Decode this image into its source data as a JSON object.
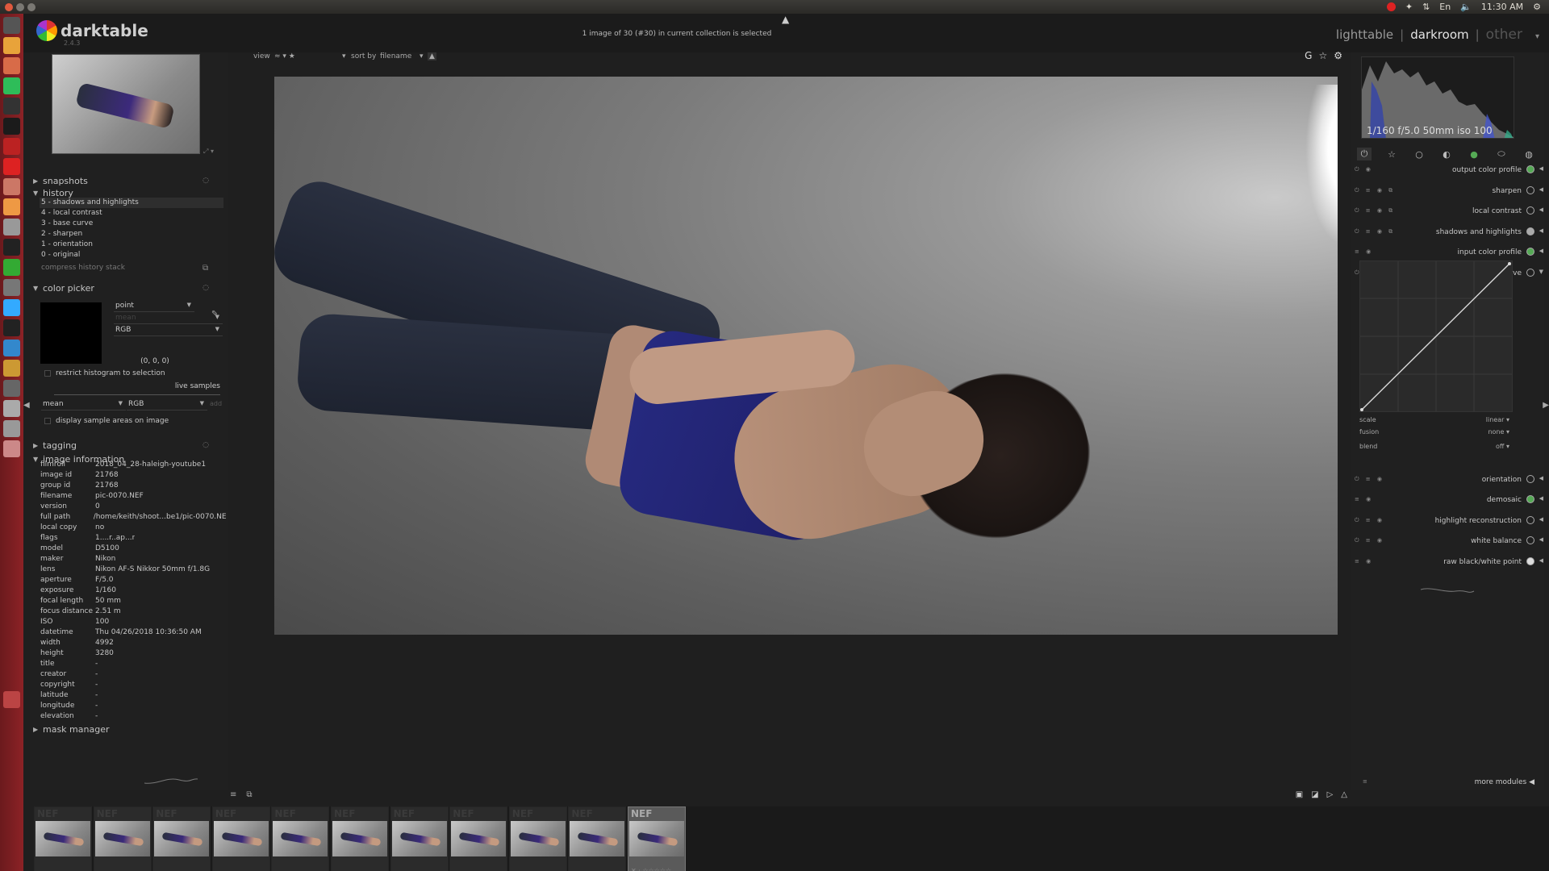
{
  "system_bar": {
    "time": "11:30 AM",
    "lang": "En"
  },
  "launcher": {
    "icons": [
      "dash-icon",
      "chrome-icon",
      "files-icon",
      "spotify-icon",
      "terminal-icon",
      "screen-icon",
      "darktable-icon",
      "opera-icon",
      "tools-icon",
      "amazon-icon",
      "disk-icon",
      "terminal2-icon",
      "spreadsheet-icon",
      "screenshot-icon",
      "twitter-icon",
      "text-editor-icon",
      "browser-icon",
      "paint-icon",
      "settings-icon",
      "drive-icon",
      "drive2-icon",
      "usb-icon",
      "trash-icon"
    ],
    "colors": [
      "#555",
      "#e8a33a",
      "#d86b48",
      "#2ebd59",
      "#333",
      "#1b1b1b",
      "#b22",
      "#d22",
      "#c76",
      "#e94",
      "#999",
      "#222",
      "#3a3",
      "#777",
      "#3af",
      "#222",
      "#38c",
      "#c93",
      "#666",
      "#aaa",
      "#999",
      "#c88",
      "#b44"
    ]
  },
  "header": {
    "app_name": "darktable",
    "version": "2.4.3",
    "status": "1 image of 30 (#30) in current collection is selected",
    "views": {
      "lighttable": "lighttable",
      "darkroom": "darkroom",
      "other": "other",
      "sep": "|"
    }
  },
  "left": {
    "snapshots": "snapshots",
    "history": {
      "title": "history",
      "items": [
        "5 - shadows and highlights",
        "4 - local contrast",
        "3 - base curve",
        "2 - sharpen",
        "1 - orientation",
        "0 - original"
      ],
      "compress": "compress history stack"
    },
    "color_picker": {
      "title": "color picker",
      "mode": "point",
      "stat": "mean",
      "model": "RGB",
      "value": "(0, 0, 0)",
      "restrict": "restrict histogram to selection",
      "live_samples": "live samples",
      "sample_stat": "mean",
      "sample_model": "RGB",
      "add": "add",
      "display_samples": "display sample areas on image"
    },
    "tagging": "tagging",
    "image_information": {
      "title": "image information",
      "rows": [
        {
          "k": "filmroll",
          "v": "2018_04_28-haleigh-youtube1"
        },
        {
          "k": "image id",
          "v": "21768"
        },
        {
          "k": "group id",
          "v": "21768"
        },
        {
          "k": "filename",
          "v": "pic-0070.NEF"
        },
        {
          "k": "version",
          "v": "0"
        },
        {
          "k": "full path",
          "v": "/home/keith/shoot...be1/pic-0070.NEF"
        },
        {
          "k": "local copy",
          "v": "no"
        },
        {
          "k": "flags",
          "v": "1....r..ap...r"
        },
        {
          "k": "model",
          "v": "D5100"
        },
        {
          "k": "maker",
          "v": "Nikon"
        },
        {
          "k": "lens",
          "v": "Nikon AF-S Nikkor 50mm f/1.8G"
        },
        {
          "k": "aperture",
          "v": "F/5.0"
        },
        {
          "k": "exposure",
          "v": "1/160"
        },
        {
          "k": "focal length",
          "v": "50 mm"
        },
        {
          "k": "focus distance",
          "v": "2.51 m"
        },
        {
          "k": "ISO",
          "v": "100"
        },
        {
          "k": "datetime",
          "v": "Thu 04/26/2018 10:36:50 AM"
        },
        {
          "k": "width",
          "v": "4992"
        },
        {
          "k": "height",
          "v": "3280"
        },
        {
          "k": "title",
          "v": "-"
        },
        {
          "k": "creator",
          "v": "-"
        },
        {
          "k": "copyright",
          "v": "-"
        },
        {
          "k": "latitude",
          "v": "-"
        },
        {
          "k": "longitude",
          "v": "-"
        },
        {
          "k": "elevation",
          "v": "-"
        }
      ]
    },
    "mask_manager": "mask manager"
  },
  "filterbar": {
    "view": "view",
    "view_val": "≈ ▾ ★",
    "sort_by": "sort by",
    "sort_val": "filename",
    "sort_dir": "▲"
  },
  "right": {
    "histogram_info": "1/160 f/5.0 50mm iso 100",
    "modules": [
      {
        "name": "output color profile",
        "ctl": "⏻ ◉"
      },
      {
        "name": "sharpen",
        "ctl": "⏻ ≡ ◉ ⧉"
      },
      {
        "name": "local contrast",
        "ctl": "⏻ ≡ ◉ ⧉"
      },
      {
        "name": "shadows and highlights",
        "ctl": "⏻ ≡ ◉ ⧉"
      },
      {
        "name": "input color profile",
        "ctl": "≡ ◉"
      },
      {
        "name": "base curve",
        "ctl": "⏻ ≡ ◉ ⧉"
      }
    ],
    "base_curve": {
      "scale_label": "scale",
      "scale_val": "linear",
      "fusion_label": "fusion",
      "fusion_val": "none",
      "blend_label": "blend",
      "blend_val": "off"
    },
    "modules2": [
      {
        "name": "orientation",
        "ctl": "⏻ ≡ ◉"
      },
      {
        "name": "demosaic",
        "ctl": "≡ ◉"
      },
      {
        "name": "highlight reconstruction",
        "ctl": "⏻ ≡ ◉"
      },
      {
        "name": "white balance",
        "ctl": "⏻ ≡ ◉"
      },
      {
        "name": "raw black/white point",
        "ctl": "≡ ◉"
      }
    ],
    "more_modules": "more modules"
  },
  "filmstrip": {
    "thumbs": [
      "NEF",
      "NEF",
      "NEF",
      "NEF",
      "NEF",
      "NEF",
      "NEF",
      "NEF",
      "NEF",
      "NEF",
      "NEF"
    ],
    "selected_index": 10,
    "stars": "✕ · ☆☆☆☆☆"
  }
}
